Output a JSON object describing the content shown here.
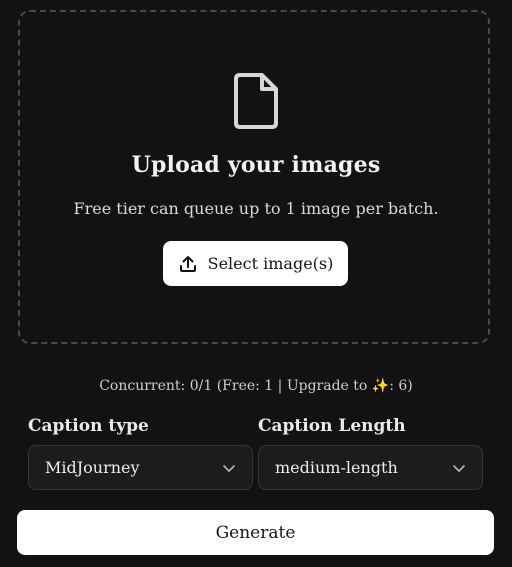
{
  "upload": {
    "title": "Upload your images",
    "subtitle": "Free tier can queue up to 1 image per batch.",
    "select_button_label": "Select image(s)",
    "file_icon": "file-icon",
    "select_icon": "upload-icon"
  },
  "status": {
    "concurrent_prefix": "Concurrent: 0/1 (Free: 1 | Upgrade to ",
    "sparkle": "✨",
    "concurrent_suffix": ": 6)"
  },
  "caption_type": {
    "label": "Caption type",
    "value": "MidJourney"
  },
  "caption_length": {
    "label": "Caption Length",
    "value": "medium-length"
  },
  "generate": {
    "label": "Generate"
  },
  "colors": {
    "background": "#121212",
    "button": "#ffffff",
    "select_bg": "#1c1c1c",
    "accent_sparkle": "#f4c47a"
  }
}
